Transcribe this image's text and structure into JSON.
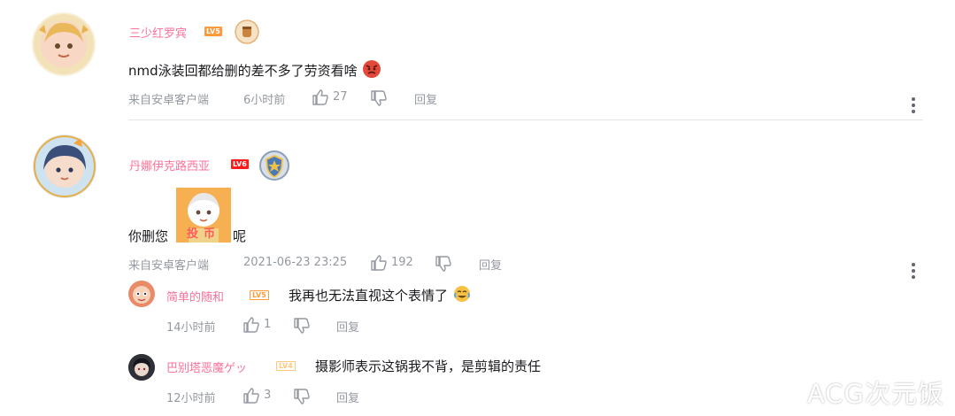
{
  "comments": [
    {
      "username": "三少红罗宾",
      "level": "LV5",
      "content": "nmd泳装回都给删的差不多了劳资看啥",
      "emoji": "angry-emoji",
      "source": "来自安卓客户端",
      "time": "6小时前",
      "likes": "27",
      "reply_label": "回复"
    },
    {
      "username": "丹娜伊克路西亚",
      "level": "LV6",
      "content_before": "你删您",
      "sticker_text": "投币",
      "content_after": "呢",
      "source": "来自安卓客户端",
      "time": "2021-06-23 23:25",
      "likes": "192",
      "reply_label": "回复",
      "replies": [
        {
          "username": "简单的随和",
          "level": "LV5",
          "content": "我再也无法直视这个表情了",
          "emoji": "laughing-tears-emoji",
          "time": "14小时前",
          "likes": "1",
          "reply_label": "回复"
        },
        {
          "username": "巴别塔恶魔ゲッ",
          "level": "LV4",
          "content": "摄影师表示这锅我不背，是剪辑的责任",
          "time": "12小时前",
          "likes": "3",
          "reply_label": "回复"
        }
      ]
    }
  ],
  "watermark": "ACG次元饭",
  "colors": {
    "username": "#fb7299",
    "meta": "#9499a0",
    "divider": "#e3e5e7"
  }
}
